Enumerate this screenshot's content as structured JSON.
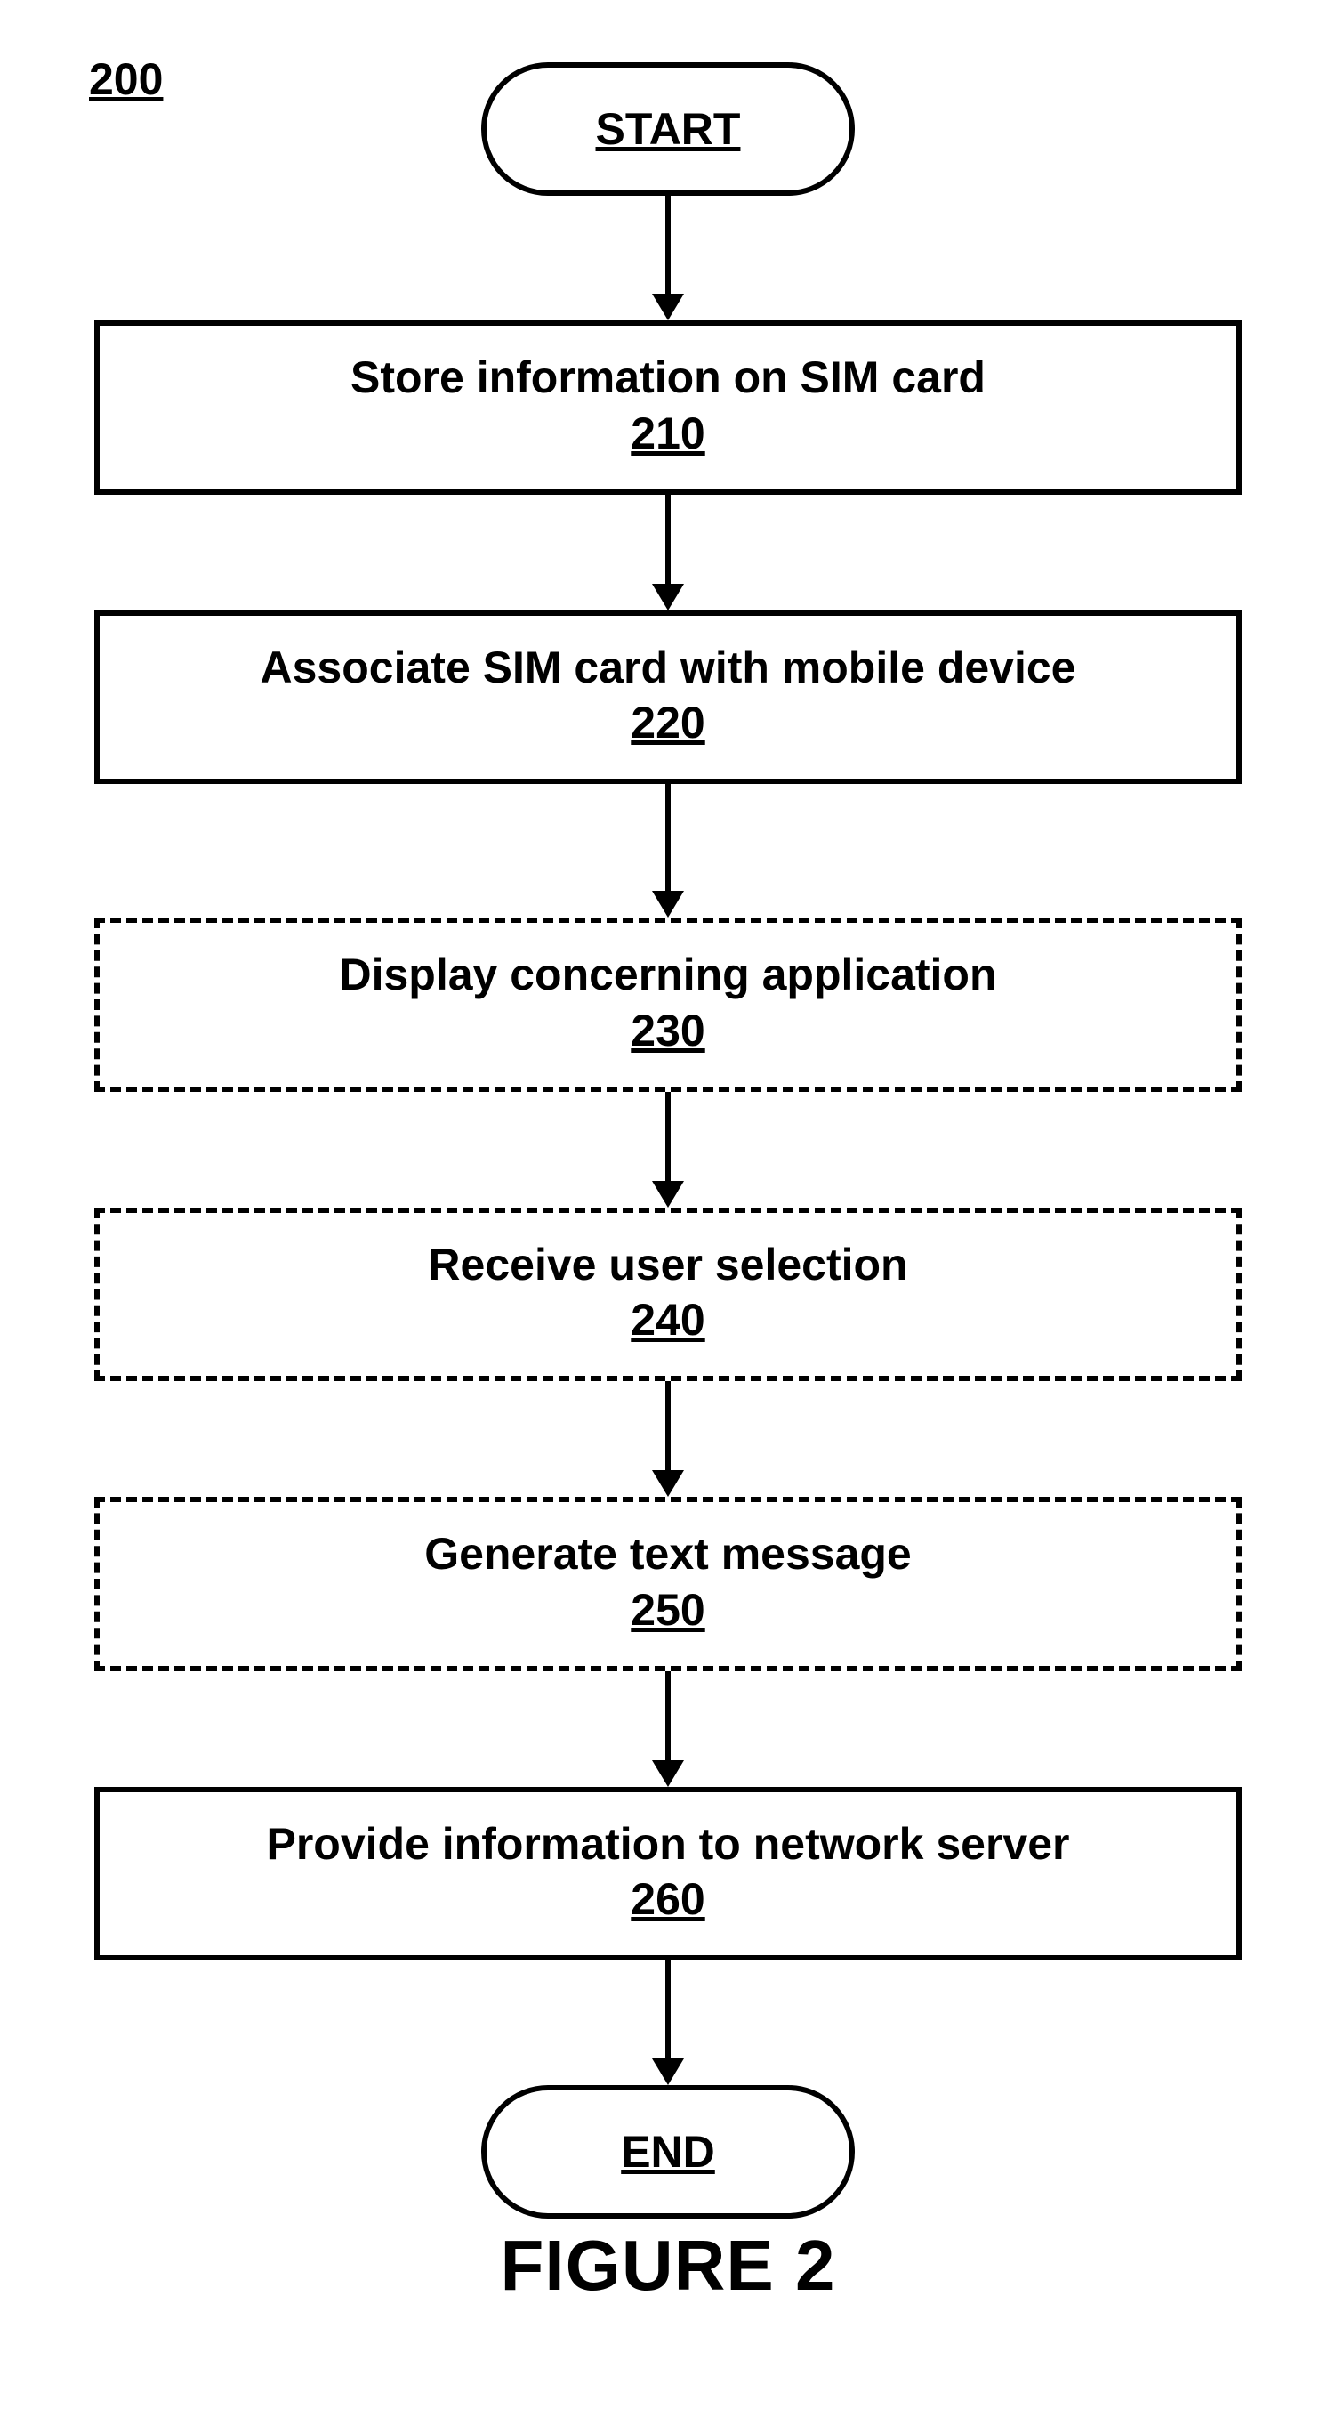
{
  "figure_ref": "200",
  "caption": "FIGURE 2",
  "nodes": {
    "start": "START",
    "end": "END",
    "step210": {
      "title": "Store information on SIM card",
      "ref": "210"
    },
    "step220": {
      "title": "Associate SIM card with mobile device",
      "ref": "220"
    },
    "step230": {
      "title": "Display concerning application",
      "ref": "230"
    },
    "step240": {
      "title": "Receive user selection",
      "ref": "240"
    },
    "step250": {
      "title": "Generate text message",
      "ref": "250"
    },
    "step260": {
      "title": "Provide information to network server",
      "ref": "260"
    }
  }
}
